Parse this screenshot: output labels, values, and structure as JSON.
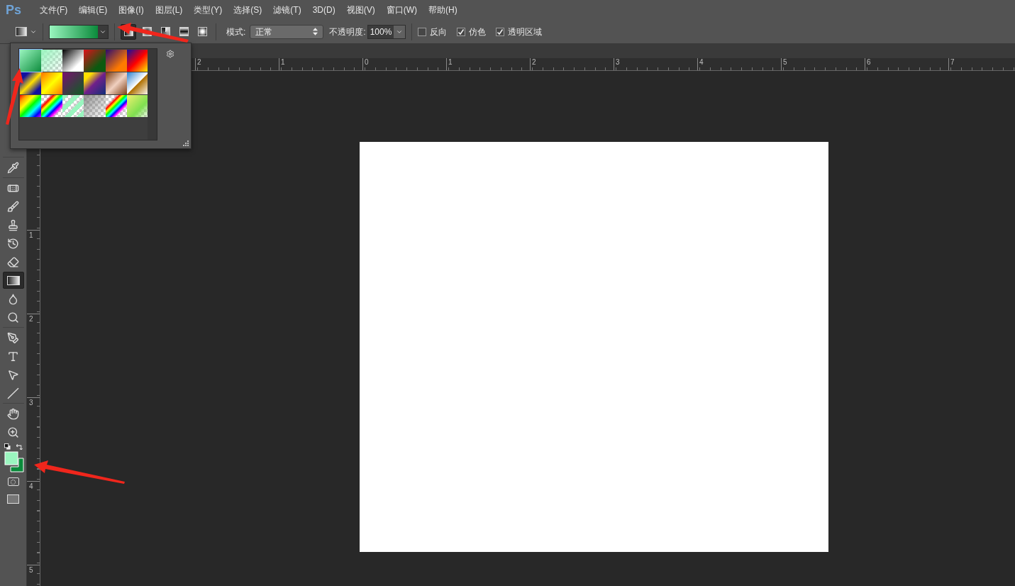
{
  "app_logo": "Ps",
  "menu": [
    "文件(F)",
    "编辑(E)",
    "图像(I)",
    "图层(L)",
    "类型(Y)",
    "选择(S)",
    "滤镜(T)",
    "3D(D)",
    "视图(V)",
    "窗口(W)",
    "帮助(H)"
  ],
  "options_bar": {
    "gradient_types": [
      {
        "kind": "linear",
        "selected": true
      },
      {
        "kind": "radial",
        "selected": false
      },
      {
        "kind": "angle",
        "selected": false
      },
      {
        "kind": "reflected",
        "selected": false
      },
      {
        "kind": "diamond",
        "selected": false
      }
    ],
    "mode_label": "模式:",
    "mode_value": "正常",
    "opacity_label": "不透明度:",
    "opacity_value": "100%",
    "checkboxes": [
      {
        "label": "反向",
        "checked": false
      },
      {
        "label": "仿色",
        "checked": true
      },
      {
        "label": "透明区域",
        "checked": true
      }
    ]
  },
  "gradient_picker": {
    "presets": [
      {
        "selected": true
      },
      {
        "selected": false
      },
      {
        "selected": false
      },
      {
        "selected": false
      },
      {
        "selected": false
      },
      {
        "selected": false
      },
      {
        "selected": false
      },
      {
        "selected": false
      },
      {
        "selected": false
      },
      {
        "selected": false
      },
      {
        "selected": false
      },
      {
        "selected": false
      },
      {
        "selected": false
      },
      {
        "selected": false
      },
      {
        "selected": false
      },
      {
        "selected": false
      },
      {
        "selected": false
      },
      {
        "selected": false
      }
    ]
  },
  "tools": [
    {
      "kind": "eyedropper",
      "selected": false
    },
    {
      "kind": "healing",
      "selected": false
    },
    {
      "kind": "brush",
      "selected": false
    },
    {
      "kind": "stamp",
      "selected": false
    },
    {
      "kind": "history",
      "selected": false
    },
    {
      "kind": "eraser",
      "selected": false
    },
    {
      "kind": "gradient",
      "selected": true
    },
    {
      "kind": "blur",
      "selected": false
    },
    {
      "kind": "dodge",
      "selected": false
    },
    {
      "kind": "pen",
      "selected": false
    },
    {
      "kind": "type",
      "selected": false
    },
    {
      "kind": "path",
      "selected": false
    },
    {
      "kind": "line",
      "selected": false
    },
    {
      "kind": "hand",
      "selected": false
    },
    {
      "kind": "zoom",
      "selected": false
    }
  ],
  "color_swatches": [
    {
      "kind": "foreground",
      "color": "#9af5bf"
    },
    {
      "kind": "background",
      "color": "#0b8a3b"
    }
  ],
  "horizontal_ruler": [
    "2",
    "1",
    "0",
    "1",
    "2",
    "3",
    "4",
    "5",
    "6",
    "7"
  ],
  "vertical_ruler": [
    "1",
    "2",
    "3",
    "4",
    "5"
  ]
}
